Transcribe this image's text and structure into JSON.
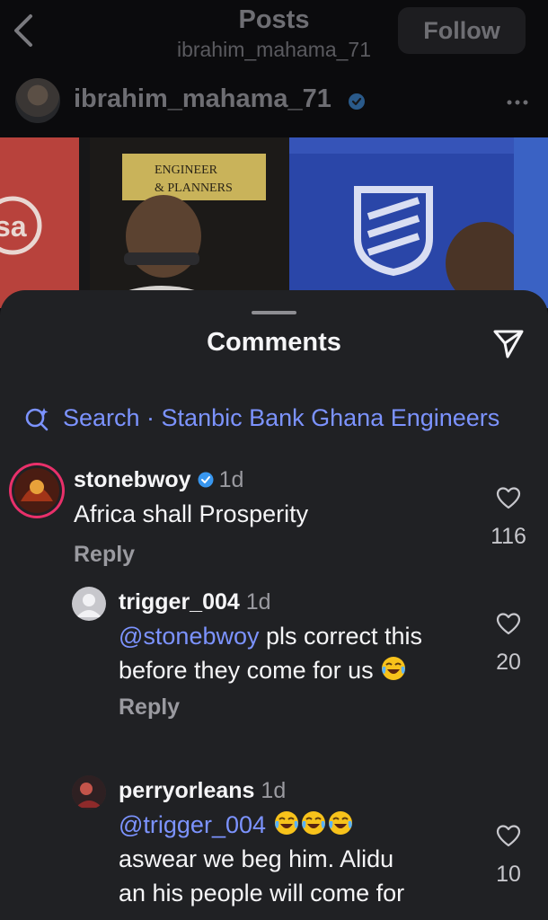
{
  "header": {
    "title": "Posts",
    "subtitle": "ibrahim_mahama_71",
    "follow_label": "Follow"
  },
  "post": {
    "author": "ibrahim_mahama_71",
    "image_text": {
      "left_logo": "sa",
      "sign_line1": "ENGINEER",
      "sign_line2": "& PLANNERS"
    }
  },
  "sheet": {
    "title": "Comments",
    "search_text": "Search · Stanbic Bank Ghana Engineers"
  },
  "comments": [
    {
      "username": "stonebwoy",
      "verified": true,
      "time": "1d",
      "text": "Africa shall Prosperity",
      "reply_label": "Reply",
      "likes": "116"
    },
    {
      "username": "trigger_004",
      "time": "1d",
      "mention": "@stonebwoy",
      "text_1": " pls correct this",
      "text_2": "before they come for us ",
      "reply_label": "Reply",
      "likes": "20"
    },
    {
      "username": "perryorleans",
      "time": "1d",
      "mention": "@trigger_004",
      "text_2": "aswear  we beg him. Alidu",
      "text_3": "an his people will come for",
      "likes": "10"
    }
  ],
  "colors": {
    "background": "#0b0b0d",
    "sheet": "#202124",
    "link": "#7c93ff",
    "verified": "#3897f0"
  },
  "icons": {
    "back": "chevron-left-icon",
    "more": "more-horizontal-icon",
    "share": "paper-plane-icon",
    "search": "search-sparkle-icon",
    "like": "heart-outline-icon",
    "verified": "verified-badge-icon",
    "emoji": "tears-of-joy-emoji"
  }
}
